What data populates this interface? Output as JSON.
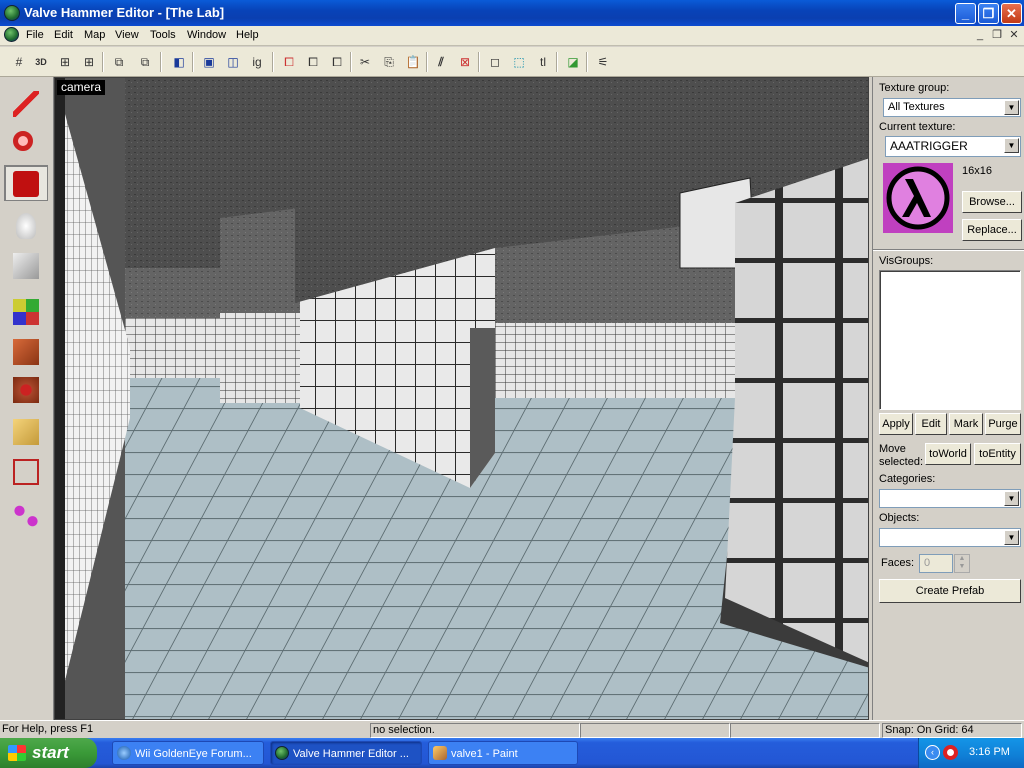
{
  "window": {
    "title": "Valve Hammer Editor - [The Lab]"
  },
  "menu": [
    "File",
    "Edit",
    "Map",
    "View",
    "Tools",
    "Window",
    "Help"
  ],
  "toolbar": {
    "text_buttons": {
      "three_d": "3D",
      "ig": "ig",
      "tl": "tl"
    }
  },
  "left_tools": [
    "selection-tool",
    "magnify-tool",
    "camera-tool",
    "entity-tool",
    "block-tool",
    "toggle-texture-application-tool",
    "apply-current-texture-tool",
    "apply-decals-tool",
    "clipping-tool",
    "vertex-manipulation-tool",
    "path-tool"
  ],
  "viewport": {
    "label": "camera"
  },
  "right_panel": {
    "texture_group_label": "Texture group:",
    "texture_group_value": "All Textures",
    "current_texture_label": "Current texture:",
    "current_texture_value": "AAATRIGGER",
    "texture_size": "16x16",
    "browse": "Browse...",
    "replace": "Replace...",
    "visgroups_label": "VisGroups:",
    "apply": "Apply",
    "edit": "Edit",
    "mark": "Mark",
    "purge": "Purge",
    "move_selected_line1": "Move",
    "move_selected_line2": "selected:",
    "to_world": "toWorld",
    "to_entity": "toEntity",
    "categories_label": "Categories:",
    "categories_value": "",
    "objects_label": "Objects:",
    "objects_value": "",
    "faces_label": "Faces:",
    "faces_value": "0",
    "create_prefab": "Create Prefab"
  },
  "status": {
    "help": "For Help, press F1",
    "selection": "no selection.",
    "snap": "Snap: On Grid: 64"
  },
  "taskbar": {
    "start": "start",
    "tasks": [
      {
        "label": "Wii GoldenEye Forum...",
        "active": false
      },
      {
        "label": "Valve Hammer Editor ...",
        "active": true
      },
      {
        "label": "valve1 - Paint",
        "active": false
      }
    ],
    "clock": "3:16 PM"
  },
  "colors": {
    "title_bar": "#0a4bc4",
    "texture_bg": "#c040c0",
    "floor_tile": "#a9bcc4"
  }
}
